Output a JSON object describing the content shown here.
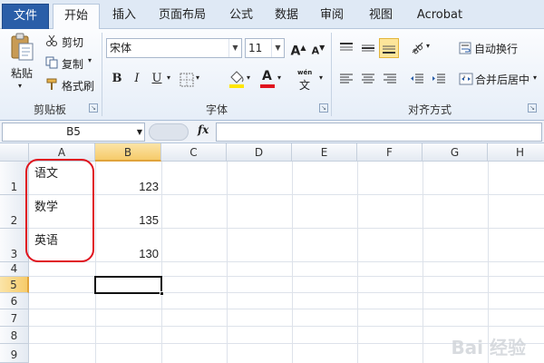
{
  "tabs": [
    "文件",
    "开始",
    "插入",
    "页面布局",
    "公式",
    "数据",
    "审阅",
    "视图",
    "Acrobat"
  ],
  "ribbon": {
    "clipboard": {
      "paste": "粘贴",
      "cut": "剪切",
      "copy": "复制",
      "copy_arrow": "▾",
      "format_painter": "格式刷",
      "group_label": "剪贴板"
    },
    "font": {
      "name": "宋体",
      "size": "11",
      "grow": "A",
      "shrink": "A",
      "bold": "B",
      "italic": "I",
      "underline": "U",
      "wen": "wén",
      "group_label": "字体"
    },
    "alignment": {
      "wrap_text": "自动换行",
      "merge_center": "合并后居中",
      "group_label": "对齐方式"
    }
  },
  "formula_bar": {
    "name_box": "B5",
    "fx": "fx",
    "value": ""
  },
  "sheet": {
    "columns": [
      "A",
      "B",
      "C",
      "D",
      "E",
      "F",
      "G",
      "H"
    ],
    "rows": [
      "1",
      "2",
      "3",
      "4",
      "5",
      "6",
      "7",
      "8",
      "9"
    ],
    "cells": {
      "A1": "语文",
      "B1": "123",
      "A2": "数学",
      "B2": "135",
      "A3": "英语",
      "B3": "130"
    },
    "selected_cell": "B5"
  },
  "colors": {
    "file_tab": "#2a5ea8",
    "highlight": "#fde59a",
    "annotation": "#e0141e",
    "font_color_bar": "#e0141e",
    "fill_color_bar": "#ffe600"
  },
  "watermark": "Bai 经验"
}
